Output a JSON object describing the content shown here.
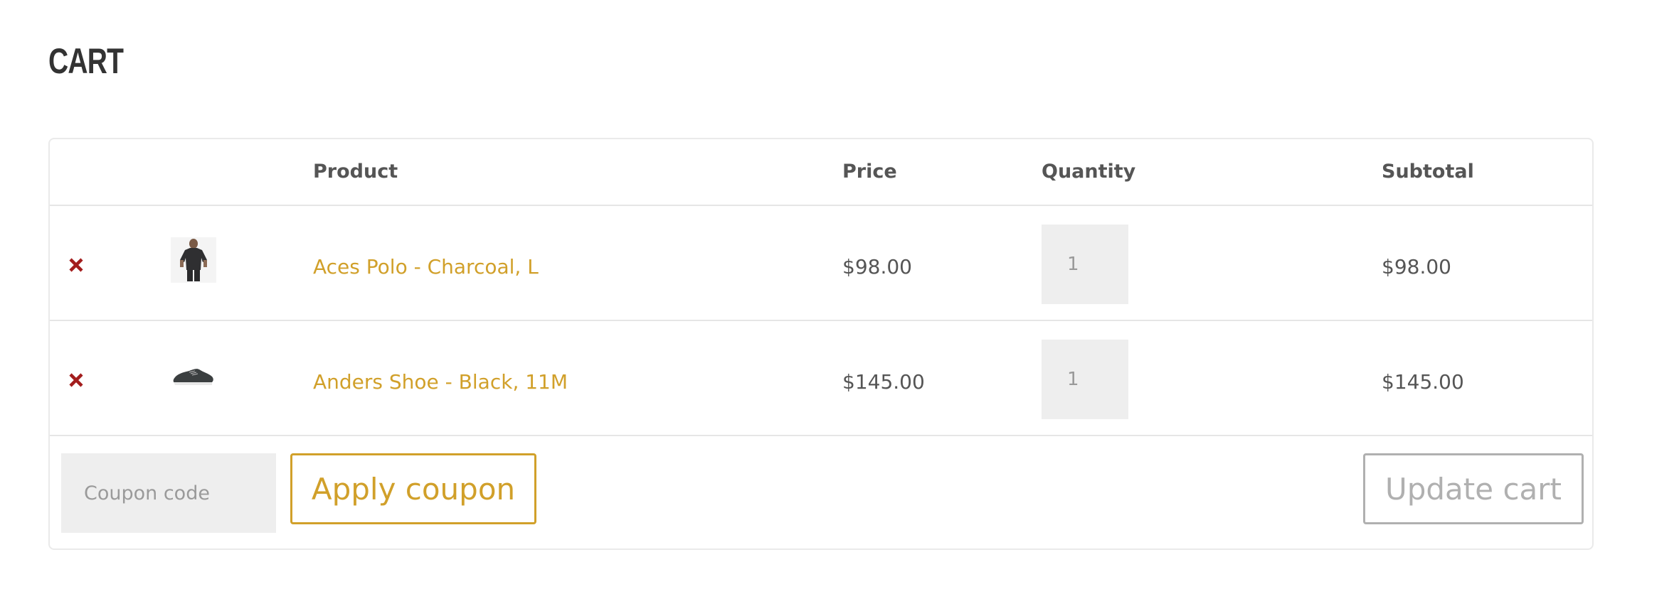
{
  "page": {
    "title": "CART"
  },
  "table": {
    "headers": {
      "product": "Product",
      "price": "Price",
      "quantity": "Quantity",
      "subtotal": "Subtotal"
    },
    "rows": [
      {
        "product": "Aces Polo - Charcoal, L",
        "price": "$98.00",
        "quantity": "1",
        "subtotal": "$98.00",
        "thumbnail": "polo-shirt-thumbnail",
        "remove_icon": "remove-x-icon"
      },
      {
        "product": "Anders Shoe - Black, 11M",
        "price": "$145.00",
        "quantity": "1",
        "subtotal": "$145.00",
        "thumbnail": "shoe-thumbnail",
        "remove_icon": "remove-x-icon"
      }
    ]
  },
  "actions": {
    "coupon_placeholder": "Coupon code",
    "apply_label": "Apply coupon",
    "update_label": "Update cart"
  },
  "colors": {
    "accent": "#d1a02a",
    "remove": "#a31d1d",
    "text": "#555555",
    "title": "#333333",
    "disabled": "#b0b0b0",
    "field_bg": "#eeeeee"
  }
}
